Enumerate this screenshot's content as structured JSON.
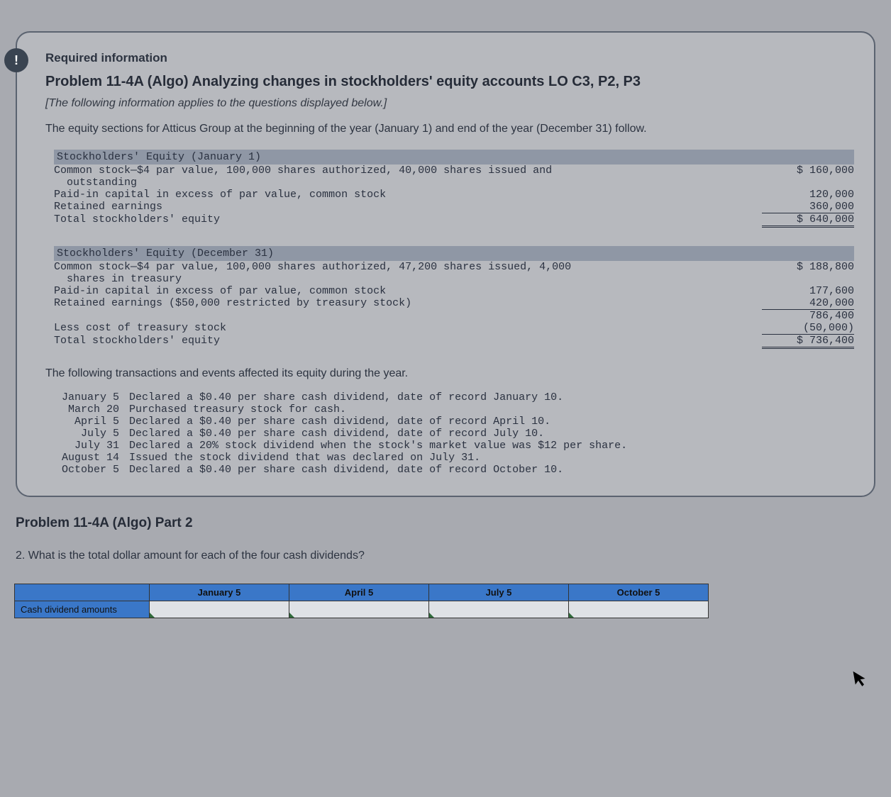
{
  "badge_glyph": "!",
  "panel": {
    "required": "Required information",
    "problem_title": "Problem 11-4A (Algo) Analyzing changes in stockholders' equity accounts LO C3, P2, P3",
    "note": "[The following information applies to the questions displayed below.]",
    "intro": "The equity sections for Atticus Group at the beginning of the year (January 1) and end of the year (December 31) follow."
  },
  "equity_jan1": {
    "title": "Stockholders' Equity (January 1)",
    "rows": [
      {
        "label": "Common stock—$4 par value, 100,000 shares authorized, 40,000 shares issued and\n  outstanding",
        "value": "$ 160,000"
      },
      {
        "label": "Paid-in capital in excess of par value, common stock",
        "value": "120,000"
      },
      {
        "label": "Retained earnings",
        "value": "360,000"
      },
      {
        "label": "Total stockholders' equity",
        "value": "$ 640,000"
      }
    ]
  },
  "equity_dec31": {
    "title": "Stockholders' Equity (December 31)",
    "rows": [
      {
        "label": "Common stock—$4 par value, 100,000 shares authorized, 47,200 shares issued, 4,000\n  shares in treasury",
        "value": "$ 188,800"
      },
      {
        "label": "Paid-in capital in excess of par value, common stock",
        "value": "177,600"
      },
      {
        "label": "Retained earnings ($50,000 restricted by treasury stock)",
        "value": "420,000"
      },
      {
        "label": "",
        "value": "786,400"
      },
      {
        "label": "Less cost of treasury stock",
        "value": "(50,000)"
      },
      {
        "label": "Total stockholders' equity",
        "value": "$ 736,400"
      }
    ]
  },
  "transactions_intro": "The following transactions and events affected its equity during the year.",
  "transactions": [
    {
      "date": "January 5",
      "desc": "Declared a $0.40 per share cash dividend, date of record January 10."
    },
    {
      "date": "March 20",
      "desc": "Purchased treasury stock for cash."
    },
    {
      "date": "April 5",
      "desc": "Declared a $0.40 per share cash dividend, date of record April 10."
    },
    {
      "date": "July 5",
      "desc": "Declared a $0.40 per share cash dividend, date of record July 10."
    },
    {
      "date": "July 31",
      "desc": "Declared a 20% stock dividend when the stock's market value was $12 per share."
    },
    {
      "date": "August 14",
      "desc": "Issued the stock dividend that was declared on July 31."
    },
    {
      "date": "October 5",
      "desc": "Declared a $0.40 per share cash dividend, date of record October 10."
    }
  ],
  "part2_title": "Problem 11-4A (Algo) Part 2",
  "question2": "2. What is the total dollar amount for each of the four cash dividends?",
  "answer_grid": {
    "row_label": "Cash dividend amounts",
    "cols": [
      "January 5",
      "April 5",
      "July 5",
      "October 5"
    ],
    "values": [
      "",
      "",
      "",
      ""
    ]
  },
  "cursor_glyph": "➤"
}
